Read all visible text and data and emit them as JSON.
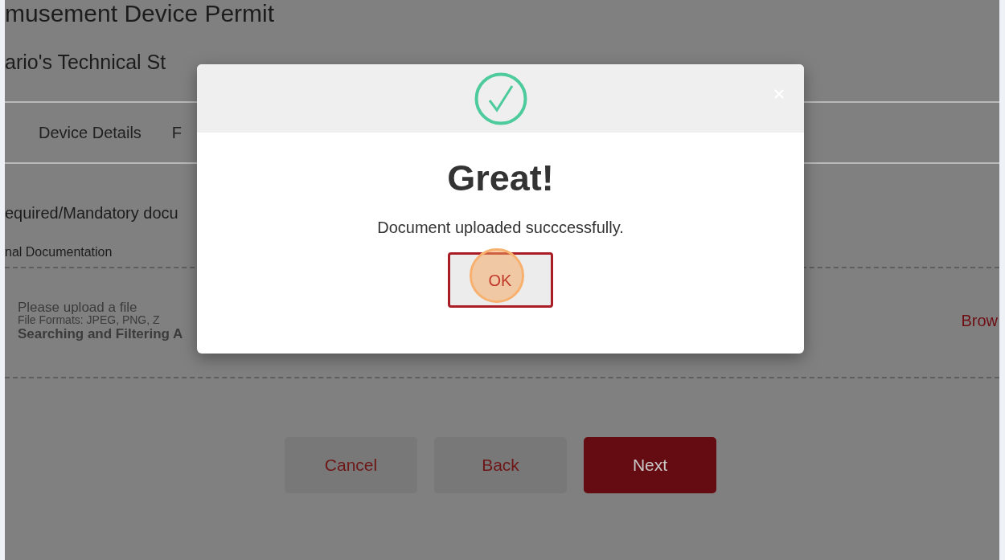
{
  "page": {
    "title": "musement Device Permit",
    "subtitle": "ario's Technical St",
    "tabs": [
      {
        "label": "Device Details"
      },
      {
        "label": "F"
      }
    ],
    "section_heading": "equired/Mandatory docu",
    "subsection": "nal Documentation",
    "upload": {
      "prompt": "Please upload a file",
      "formats": "File Formats: JPEG, PNG, Z",
      "file_name": "Searching and Filtering A",
      "browse": "Brow"
    },
    "buttons": [
      {
        "label": "Cancel",
        "kind": "secondary"
      },
      {
        "label": "Back",
        "kind": "secondary"
      },
      {
        "label": "Next",
        "kind": "primary"
      }
    ]
  },
  "dialog": {
    "title": "Great!",
    "message": "Document uploaded succcessfully.",
    "ok": "OK"
  }
}
